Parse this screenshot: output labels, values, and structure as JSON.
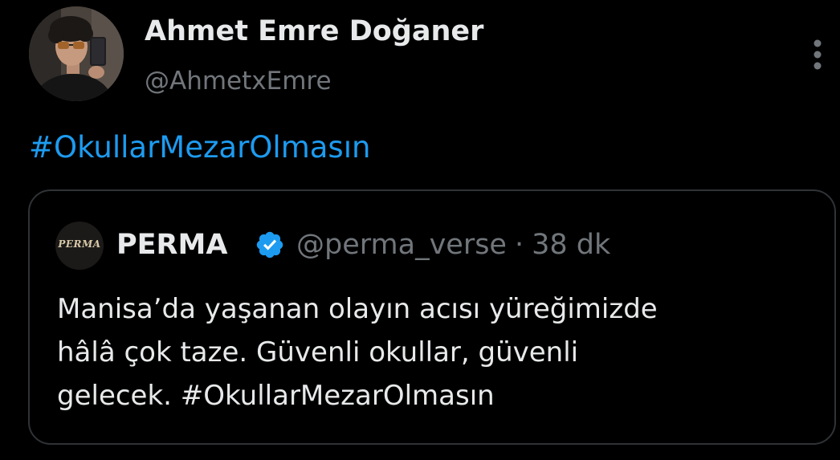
{
  "author": {
    "display_name": "Ahmet Emre Doğaner",
    "handle": "@AhmetxEmre",
    "avatar_icon": "profile-photo"
  },
  "more_icon": "more-vertical-icon",
  "tweet": {
    "hashtag": "#OkullarMezarOlmasın"
  },
  "quote": {
    "avatar_text": "PERMA",
    "display_name": "PERMA",
    "verified_icon": "verified-badge-icon",
    "handle": "@perma_verse",
    "separator": "·",
    "time": "38 dk",
    "lines": [
      "Manisa’da yaşanan olayın acısı yüreğimizde",
      "hâlâ çok taze. Güvenli okullar, güvenli",
      "gelecek. #OkullarMezarOlmasın"
    ]
  },
  "colors": {
    "background": "#000000",
    "primary_text": "#e7e9ea",
    "secondary_text": "#71767b",
    "link": "#1d9bf0",
    "border": "#2f3336",
    "verified": "#1d9bf0"
  }
}
